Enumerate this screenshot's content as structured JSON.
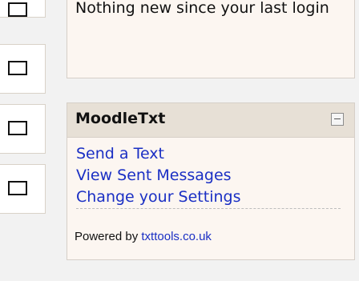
{
  "recent_activity": {
    "message": "Nothing new since your last login"
  },
  "moodletxt": {
    "title": "MoodleTxt",
    "links": [
      "Send a Text",
      "View Sent Messages",
      "Change your Settings"
    ],
    "powered_prefix": "Powered by",
    "powered_link": "txttools.co.uk"
  }
}
